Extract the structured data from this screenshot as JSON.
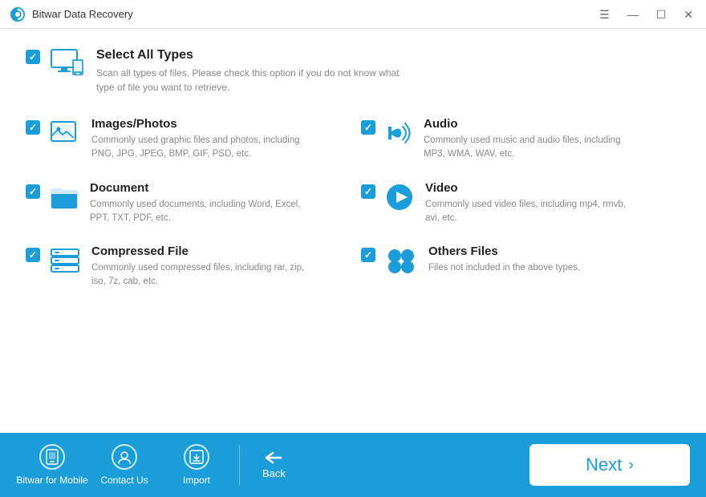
{
  "window": {
    "title": "Bitwar Data Recovery",
    "controls": {
      "menu": "☰",
      "minimize": "—",
      "maximize": "☐",
      "close": "✕"
    }
  },
  "select_all": {
    "label": "Select All Types",
    "description": "Scan all types of files. Please check this option if you do not know what type of file you want to retrieve.",
    "checked": true
  },
  "file_types": [
    {
      "id": "images",
      "label": "Images/Photos",
      "description": "Commonly used graphic files and photos, including PNG, JPG, JPEG, BMP, GIF, PSD, etc.",
      "checked": true
    },
    {
      "id": "audio",
      "label": "Audio",
      "description": "Commonly used music and audio files, including MP3, WMA, WAV, etc.",
      "checked": true
    },
    {
      "id": "document",
      "label": "Document",
      "description": "Commonly used documents, including Word, Excel, PPT, TXT, PDF, etc.",
      "checked": true
    },
    {
      "id": "video",
      "label": "Video",
      "description": "Commonly used video files, including mp4, rmvb, avi, etc.",
      "checked": true
    },
    {
      "id": "compressed",
      "label": "Compressed File",
      "description": "Commonly used compressed files, including rar, zip, iso, 7z, cab, etc.",
      "checked": true
    },
    {
      "id": "others",
      "label": "Others Files",
      "description": "Files not included in the above types.",
      "checked": true
    }
  ],
  "bottom_bar": {
    "mobile_label": "Bitwar for Mobile",
    "contact_label": "Contact Us",
    "import_label": "Import",
    "back_label": "Back",
    "next_label": "Next"
  }
}
